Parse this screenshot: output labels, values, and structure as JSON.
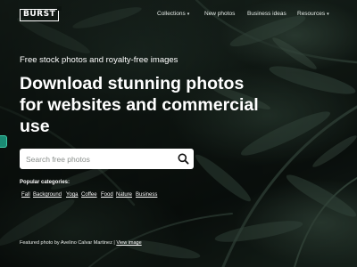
{
  "header": {
    "logo_text": "BURST",
    "nav": [
      {
        "label": "Collections",
        "has_dropdown": true
      },
      {
        "label": "New photos",
        "has_dropdown": false
      },
      {
        "label": "Business ideas",
        "has_dropdown": false
      },
      {
        "label": "Resources",
        "has_dropdown": true
      }
    ],
    "caret_glyph": "▾"
  },
  "hero": {
    "tagline": "Free stock photos and royalty-free images",
    "headline": "Download stunning photos for websites and commercial use"
  },
  "search": {
    "placeholder": "Search free photos",
    "value": "",
    "icon": "search-icon"
  },
  "popular": {
    "label": "Popular categories:",
    "categories": [
      "Fall",
      "Background",
      "Yoga",
      "Coffee",
      "Food",
      "Nature",
      "Business"
    ]
  },
  "credit": {
    "prefix": "Featured photo by Avelino Calvar Martinez |",
    "link_label": "View image"
  },
  "colors": {
    "text": "#ffffff",
    "search_bg": "#ffffff",
    "side_tab": "#1a8a73"
  },
  "side_tab_icon": "chat-tab-icon"
}
